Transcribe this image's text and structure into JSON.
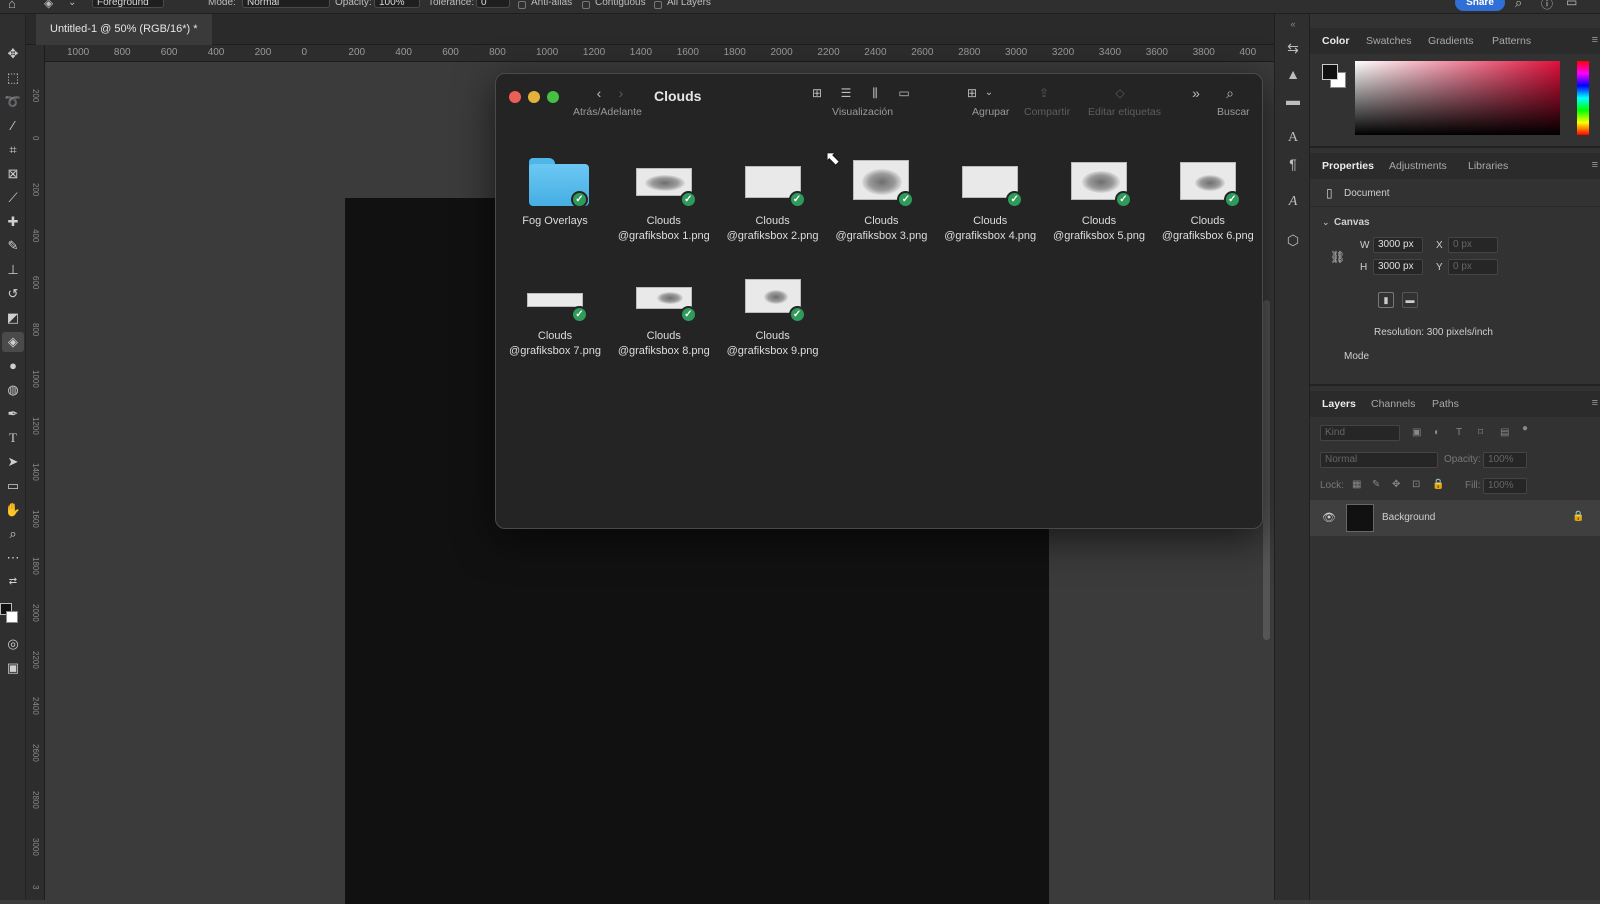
{
  "options_bar": {
    "tool_preset": "Foreground",
    "mode_label": "Mode:",
    "mode_value": "Normal",
    "opacity_label": "Opacity:",
    "opacity_value": "100%",
    "tolerance_label": "Tolerance:",
    "tolerance_value": "0",
    "anti_alias": "Anti-alias",
    "contiguous": "Contiguous",
    "all_layers": "All Layers",
    "share": "Share"
  },
  "document": {
    "tab_title": "Untitled-1 @ 50% (RGB/16*) *"
  },
  "ruler": {
    "h_ticks": [
      "1000",
      "800",
      "600",
      "400",
      "200",
      "0",
      "200",
      "400",
      "600",
      "800",
      "1000",
      "1200",
      "1400",
      "1600",
      "1800",
      "2000",
      "2200",
      "2400",
      "2600",
      "2800",
      "3000",
      "3200",
      "3400",
      "3600",
      "3800",
      "400"
    ],
    "v_ticks": [
      "200",
      "0",
      "200",
      "400",
      "600",
      "800",
      "1000",
      "1200",
      "1400",
      "1600",
      "1800",
      "2000",
      "2200",
      "2400",
      "2600",
      "2800",
      "3000",
      "3"
    ]
  },
  "finder": {
    "title": "Clouds",
    "nav_label": "Atrás/Adelante",
    "view_label": "Visualización",
    "group_label": "Agrupar",
    "share_label": "Compartir",
    "tags_label": "Editar etiquetas",
    "search_label": "Buscar",
    "items": [
      {
        "name": "Fog Overlays",
        "kind": "folder"
      },
      {
        "name": "Clouds\n@grafiksbox 1.png",
        "kind": "image"
      },
      {
        "name": "Clouds\n@grafiksbox 2.png",
        "kind": "image"
      },
      {
        "name": "Clouds\n@grafiksbox 3.png",
        "kind": "image"
      },
      {
        "name": "Clouds\n@grafiksbox 4.png",
        "kind": "image"
      },
      {
        "name": "Clouds\n@grafiksbox 5.png",
        "kind": "image"
      },
      {
        "name": "Clouds\n@grafiksbox 6.png",
        "kind": "image"
      },
      {
        "name": "Clouds\n@grafiksbox 7.png",
        "kind": "image"
      },
      {
        "name": "Clouds\n@grafiksbox 8.png",
        "kind": "image"
      },
      {
        "name": "Clouds\n@grafiksbox 9.png",
        "kind": "image"
      }
    ],
    "checkmark_glyph": "✓"
  },
  "color_panel": {
    "tabs": [
      "Color",
      "Swatches",
      "Gradients",
      "Patterns"
    ],
    "active_tab": "Color",
    "picker_hue": "#e0103c"
  },
  "properties_panel": {
    "tabs": [
      "Properties",
      "Adjustments",
      "Libraries"
    ],
    "active_tab": "Properties",
    "document_label": "Document",
    "canvas_label": "Canvas",
    "w_label": "W",
    "w_value": "3000 px",
    "h_label": "H",
    "h_value": "3000 px",
    "x_label": "X",
    "x_value": "0 px",
    "y_label": "Y",
    "y_value": "0 px",
    "resolution": "Resolution: 300 pixels/inch",
    "mode_label": "Mode"
  },
  "layers_panel": {
    "tabs": [
      "Layers",
      "Channels",
      "Paths"
    ],
    "active_tab": "Layers",
    "kind_placeholder": "Kind",
    "blend_mode": "Normal",
    "opacity_label": "Opacity:",
    "opacity_value": "100%",
    "lock_label": "Lock:",
    "fill_label": "Fill:",
    "fill_value": "100%",
    "layers": [
      {
        "name": "Background",
        "visible": true,
        "locked": true
      }
    ]
  },
  "colors": {
    "accent_blue": "#2f6fd6",
    "check_green": "#2f9b5a",
    "folder_blue": "#4fb6ea",
    "close_red": "#ec5f57",
    "min_yellow": "#e2b33c",
    "max_green": "#45c043"
  }
}
